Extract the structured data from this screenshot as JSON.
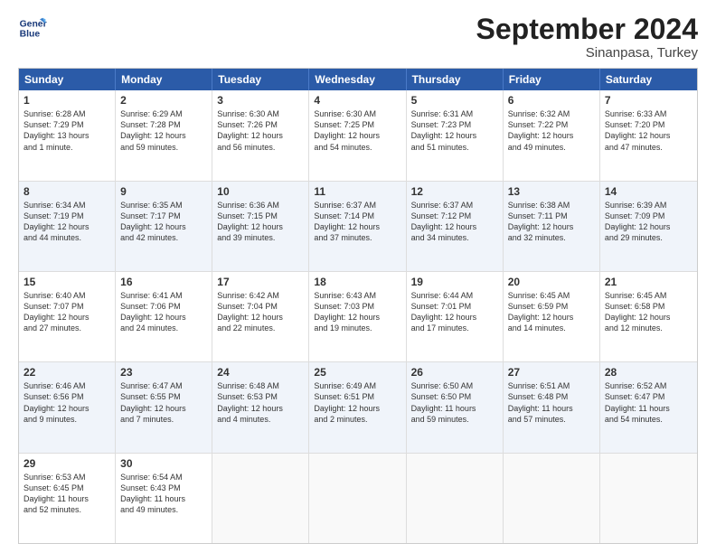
{
  "header": {
    "logo_line1": "General",
    "logo_line2": "Blue",
    "month": "September 2024",
    "location": "Sinanpasa, Turkey"
  },
  "weekdays": [
    "Sunday",
    "Monday",
    "Tuesday",
    "Wednesday",
    "Thursday",
    "Friday",
    "Saturday"
  ],
  "rows": [
    [
      {
        "day": "1",
        "text": "Sunrise: 6:28 AM\nSunset: 7:29 PM\nDaylight: 13 hours\nand 1 minute."
      },
      {
        "day": "2",
        "text": "Sunrise: 6:29 AM\nSunset: 7:28 PM\nDaylight: 12 hours\nand 59 minutes."
      },
      {
        "day": "3",
        "text": "Sunrise: 6:30 AM\nSunset: 7:26 PM\nDaylight: 12 hours\nand 56 minutes."
      },
      {
        "day": "4",
        "text": "Sunrise: 6:30 AM\nSunset: 7:25 PM\nDaylight: 12 hours\nand 54 minutes."
      },
      {
        "day": "5",
        "text": "Sunrise: 6:31 AM\nSunset: 7:23 PM\nDaylight: 12 hours\nand 51 minutes."
      },
      {
        "day": "6",
        "text": "Sunrise: 6:32 AM\nSunset: 7:22 PM\nDaylight: 12 hours\nand 49 minutes."
      },
      {
        "day": "7",
        "text": "Sunrise: 6:33 AM\nSunset: 7:20 PM\nDaylight: 12 hours\nand 47 minutes."
      }
    ],
    [
      {
        "day": "8",
        "text": "Sunrise: 6:34 AM\nSunset: 7:19 PM\nDaylight: 12 hours\nand 44 minutes."
      },
      {
        "day": "9",
        "text": "Sunrise: 6:35 AM\nSunset: 7:17 PM\nDaylight: 12 hours\nand 42 minutes."
      },
      {
        "day": "10",
        "text": "Sunrise: 6:36 AM\nSunset: 7:15 PM\nDaylight: 12 hours\nand 39 minutes."
      },
      {
        "day": "11",
        "text": "Sunrise: 6:37 AM\nSunset: 7:14 PM\nDaylight: 12 hours\nand 37 minutes."
      },
      {
        "day": "12",
        "text": "Sunrise: 6:37 AM\nSunset: 7:12 PM\nDaylight: 12 hours\nand 34 minutes."
      },
      {
        "day": "13",
        "text": "Sunrise: 6:38 AM\nSunset: 7:11 PM\nDaylight: 12 hours\nand 32 minutes."
      },
      {
        "day": "14",
        "text": "Sunrise: 6:39 AM\nSunset: 7:09 PM\nDaylight: 12 hours\nand 29 minutes."
      }
    ],
    [
      {
        "day": "15",
        "text": "Sunrise: 6:40 AM\nSunset: 7:07 PM\nDaylight: 12 hours\nand 27 minutes."
      },
      {
        "day": "16",
        "text": "Sunrise: 6:41 AM\nSunset: 7:06 PM\nDaylight: 12 hours\nand 24 minutes."
      },
      {
        "day": "17",
        "text": "Sunrise: 6:42 AM\nSunset: 7:04 PM\nDaylight: 12 hours\nand 22 minutes."
      },
      {
        "day": "18",
        "text": "Sunrise: 6:43 AM\nSunset: 7:03 PM\nDaylight: 12 hours\nand 19 minutes."
      },
      {
        "day": "19",
        "text": "Sunrise: 6:44 AM\nSunset: 7:01 PM\nDaylight: 12 hours\nand 17 minutes."
      },
      {
        "day": "20",
        "text": "Sunrise: 6:45 AM\nSunset: 6:59 PM\nDaylight: 12 hours\nand 14 minutes."
      },
      {
        "day": "21",
        "text": "Sunrise: 6:45 AM\nSunset: 6:58 PM\nDaylight: 12 hours\nand 12 minutes."
      }
    ],
    [
      {
        "day": "22",
        "text": "Sunrise: 6:46 AM\nSunset: 6:56 PM\nDaylight: 12 hours\nand 9 minutes."
      },
      {
        "day": "23",
        "text": "Sunrise: 6:47 AM\nSunset: 6:55 PM\nDaylight: 12 hours\nand 7 minutes."
      },
      {
        "day": "24",
        "text": "Sunrise: 6:48 AM\nSunset: 6:53 PM\nDaylight: 12 hours\nand 4 minutes."
      },
      {
        "day": "25",
        "text": "Sunrise: 6:49 AM\nSunset: 6:51 PM\nDaylight: 12 hours\nand 2 minutes."
      },
      {
        "day": "26",
        "text": "Sunrise: 6:50 AM\nSunset: 6:50 PM\nDaylight: 11 hours\nand 59 minutes."
      },
      {
        "day": "27",
        "text": "Sunrise: 6:51 AM\nSunset: 6:48 PM\nDaylight: 11 hours\nand 57 minutes."
      },
      {
        "day": "28",
        "text": "Sunrise: 6:52 AM\nSunset: 6:47 PM\nDaylight: 11 hours\nand 54 minutes."
      }
    ],
    [
      {
        "day": "29",
        "text": "Sunrise: 6:53 AM\nSunset: 6:45 PM\nDaylight: 11 hours\nand 52 minutes."
      },
      {
        "day": "30",
        "text": "Sunrise: 6:54 AM\nSunset: 6:43 PM\nDaylight: 11 hours\nand 49 minutes."
      },
      {
        "day": "",
        "text": ""
      },
      {
        "day": "",
        "text": ""
      },
      {
        "day": "",
        "text": ""
      },
      {
        "day": "",
        "text": ""
      },
      {
        "day": "",
        "text": ""
      }
    ]
  ]
}
